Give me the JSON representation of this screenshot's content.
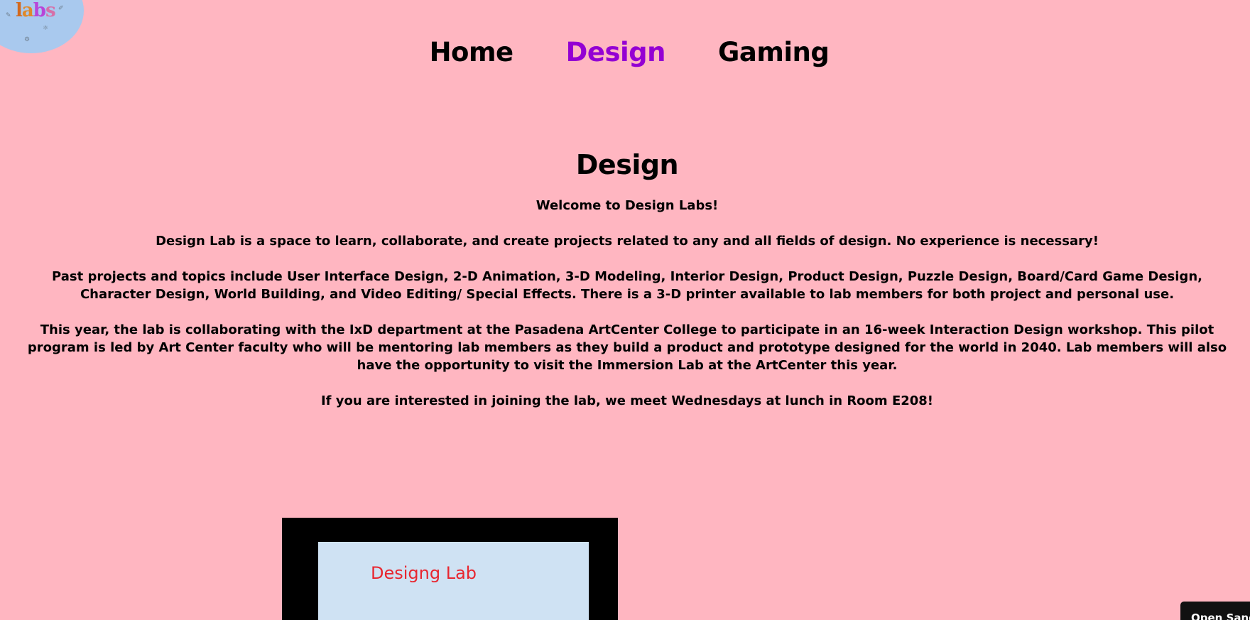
{
  "logo": {
    "text_parts": [
      "l",
      "a",
      "b",
      "s"
    ]
  },
  "nav": {
    "items": [
      {
        "label": "Home",
        "active": false
      },
      {
        "label": "Design",
        "active": true
      },
      {
        "label": "Gaming",
        "active": false
      }
    ]
  },
  "main": {
    "heading": "Design",
    "paragraphs": [
      "Welcome to Design Labs!",
      "Design Lab is a space to learn, collaborate, and create projects related to any and all fields of design. No experience is necessary!",
      "Past projects and topics include User Interface Design, 2-D Animation, 3-D Modeling, Interior Design, Product Design, Puzzle Design, Board/Card Game Design, Character Design, World Building, and Video Editing/ Special Effects. There is a 3-D printer available to lab members for both project and personal use.",
      "This year, the lab is collaborating with the IxD department at the Pasadena ArtCenter College to participate in an 16-week Interaction Design workshop. This pilot program is led by Art Center faculty who will be mentoring lab members as they build a product and prototype designed for the world in 2040. Lab members will also have the opportunity to visit the Immersion Lab at the ArtCenter this year.",
      "If you are interested in joining the lab, we meet Wednesdays at lunch in Room E208!"
    ]
  },
  "image": {
    "title": "Designg Lab"
  },
  "sandbox_button": {
    "label": "Open Sandbox"
  },
  "colors": {
    "background": "#ffb6c1",
    "active_nav": "#9400d3",
    "logo_bg": "#a9c9ee",
    "image_title": "#e8262f"
  }
}
